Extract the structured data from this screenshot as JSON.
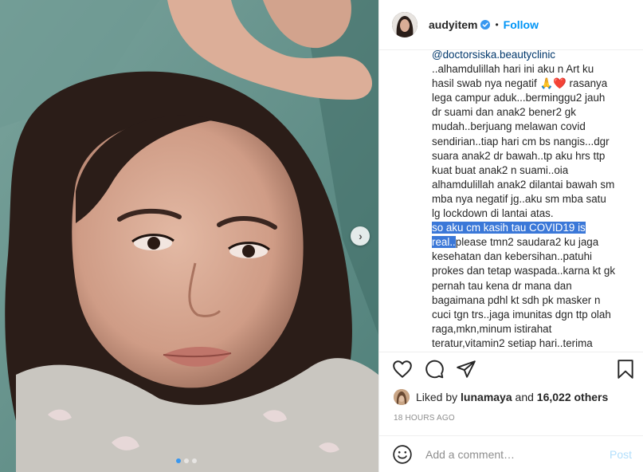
{
  "post": {
    "photo_icon_names": [
      "next-arrow-icon"
    ],
    "carousel": {
      "dots": 3,
      "active_index": 1
    }
  },
  "header": {
    "username": "audyitem",
    "separator": "•",
    "follow_label": "Follow",
    "verified_icon": "verified-badge-icon"
  },
  "caption": {
    "lines": [
      "..alhamdulillah hari ini aku n Art ku",
      "hasil swab nya negatif 🙏❤️ rasanya",
      "lega campur aduk...berminggu2 jauh",
      "dr suami dan anak2 bener2 gk",
      "mudah..berjuang melawan covid",
      "sendirian..tiap hari cm bs nangis...dgr",
      "suara anak2 dr bawah..tp aku hrs ttp",
      "kuat buat anak2 n suami..oia",
      "alhamdulillah anak2 dilantai bawah sm",
      "mba nya negatif jg..aku sm mba satu",
      "lg lockdown di lantai atas."
    ],
    "mention": "@doctorsiska.beautyclinic",
    "highlight_line1": "so aku cm kasih tau COVID19 is",
    "highlight_line2": "real..",
    "after_highlight": "please tmn2 saudara2 ku jaga",
    "lines2": [
      "kesehatan dan kebersihan..patuhi",
      "prokes dan tetap waspada..karna kt gk",
      "pernah tau kena dr mana dan",
      "bagaimana pdhl kt sdh pk masker n",
      "cuci tgn trs..jaga imunitas dgn ttp olah",
      "raga,mkn,minum istirahat",
      "teratur,vitamin2 setiap hari..terima"
    ]
  },
  "actions": {
    "icons": [
      "heart-icon",
      "comment-icon",
      "share-icon",
      "bookmark-icon"
    ]
  },
  "likes": {
    "prefix": "Liked by",
    "liker": "lunamaya",
    "conjunction": "and",
    "count": "16,022 others"
  },
  "timestamp": "18 HOURS AGO",
  "comment": {
    "placeholder": "Add a comment…",
    "post_label": "Post",
    "emoji_icon": "emoji-icon"
  },
  "colors": {
    "accent": "#0095f6",
    "highlight": "#3b78d8",
    "mention": "#00376b",
    "muted": "#8e8e8e"
  }
}
